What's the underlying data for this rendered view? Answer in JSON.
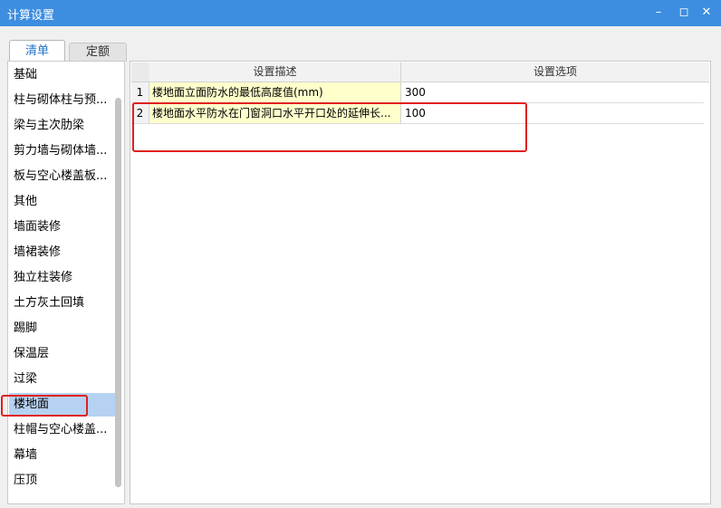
{
  "window": {
    "title": "计算设置",
    "minimize_icon": "minimize-icon",
    "restore_icon": "restore-icon",
    "close_icon": "close-icon"
  },
  "tabs": [
    {
      "label": "清单",
      "active": true
    },
    {
      "label": "定额",
      "active": false
    }
  ],
  "sidebar": {
    "items": [
      {
        "label": "基础"
      },
      {
        "label": "柱与砌体柱与预..."
      },
      {
        "label": "梁与主次肋梁"
      },
      {
        "label": "剪力墙与砌体墙..."
      },
      {
        "label": "板与空心楼盖板..."
      },
      {
        "label": "其他"
      },
      {
        "label": "墙面装修"
      },
      {
        "label": "墙裙装修"
      },
      {
        "label": "独立柱装修"
      },
      {
        "label": "土方灰土回填"
      },
      {
        "label": "踢脚"
      },
      {
        "label": "保温层"
      },
      {
        "label": "过梁"
      },
      {
        "label": "楼地面",
        "selected": true
      },
      {
        "label": "柱帽与空心楼盖..."
      },
      {
        "label": "幕墙"
      },
      {
        "label": "压顶"
      }
    ]
  },
  "table": {
    "columns": [
      "设置描述",
      "设置选项"
    ],
    "rows": [
      {
        "num": "1",
        "desc": "楼地面立面防水的最低高度值(mm)",
        "value": "300"
      },
      {
        "num": "2",
        "desc": "楼地面水平防水在门窗洞口水平开口处的延伸长...",
        "value": "100"
      }
    ]
  },
  "colors": {
    "titlebar": "#3d8ee0",
    "highlight": "#e02020",
    "selected": "#b6d2f2",
    "desc_cell": "#ffffcc"
  }
}
